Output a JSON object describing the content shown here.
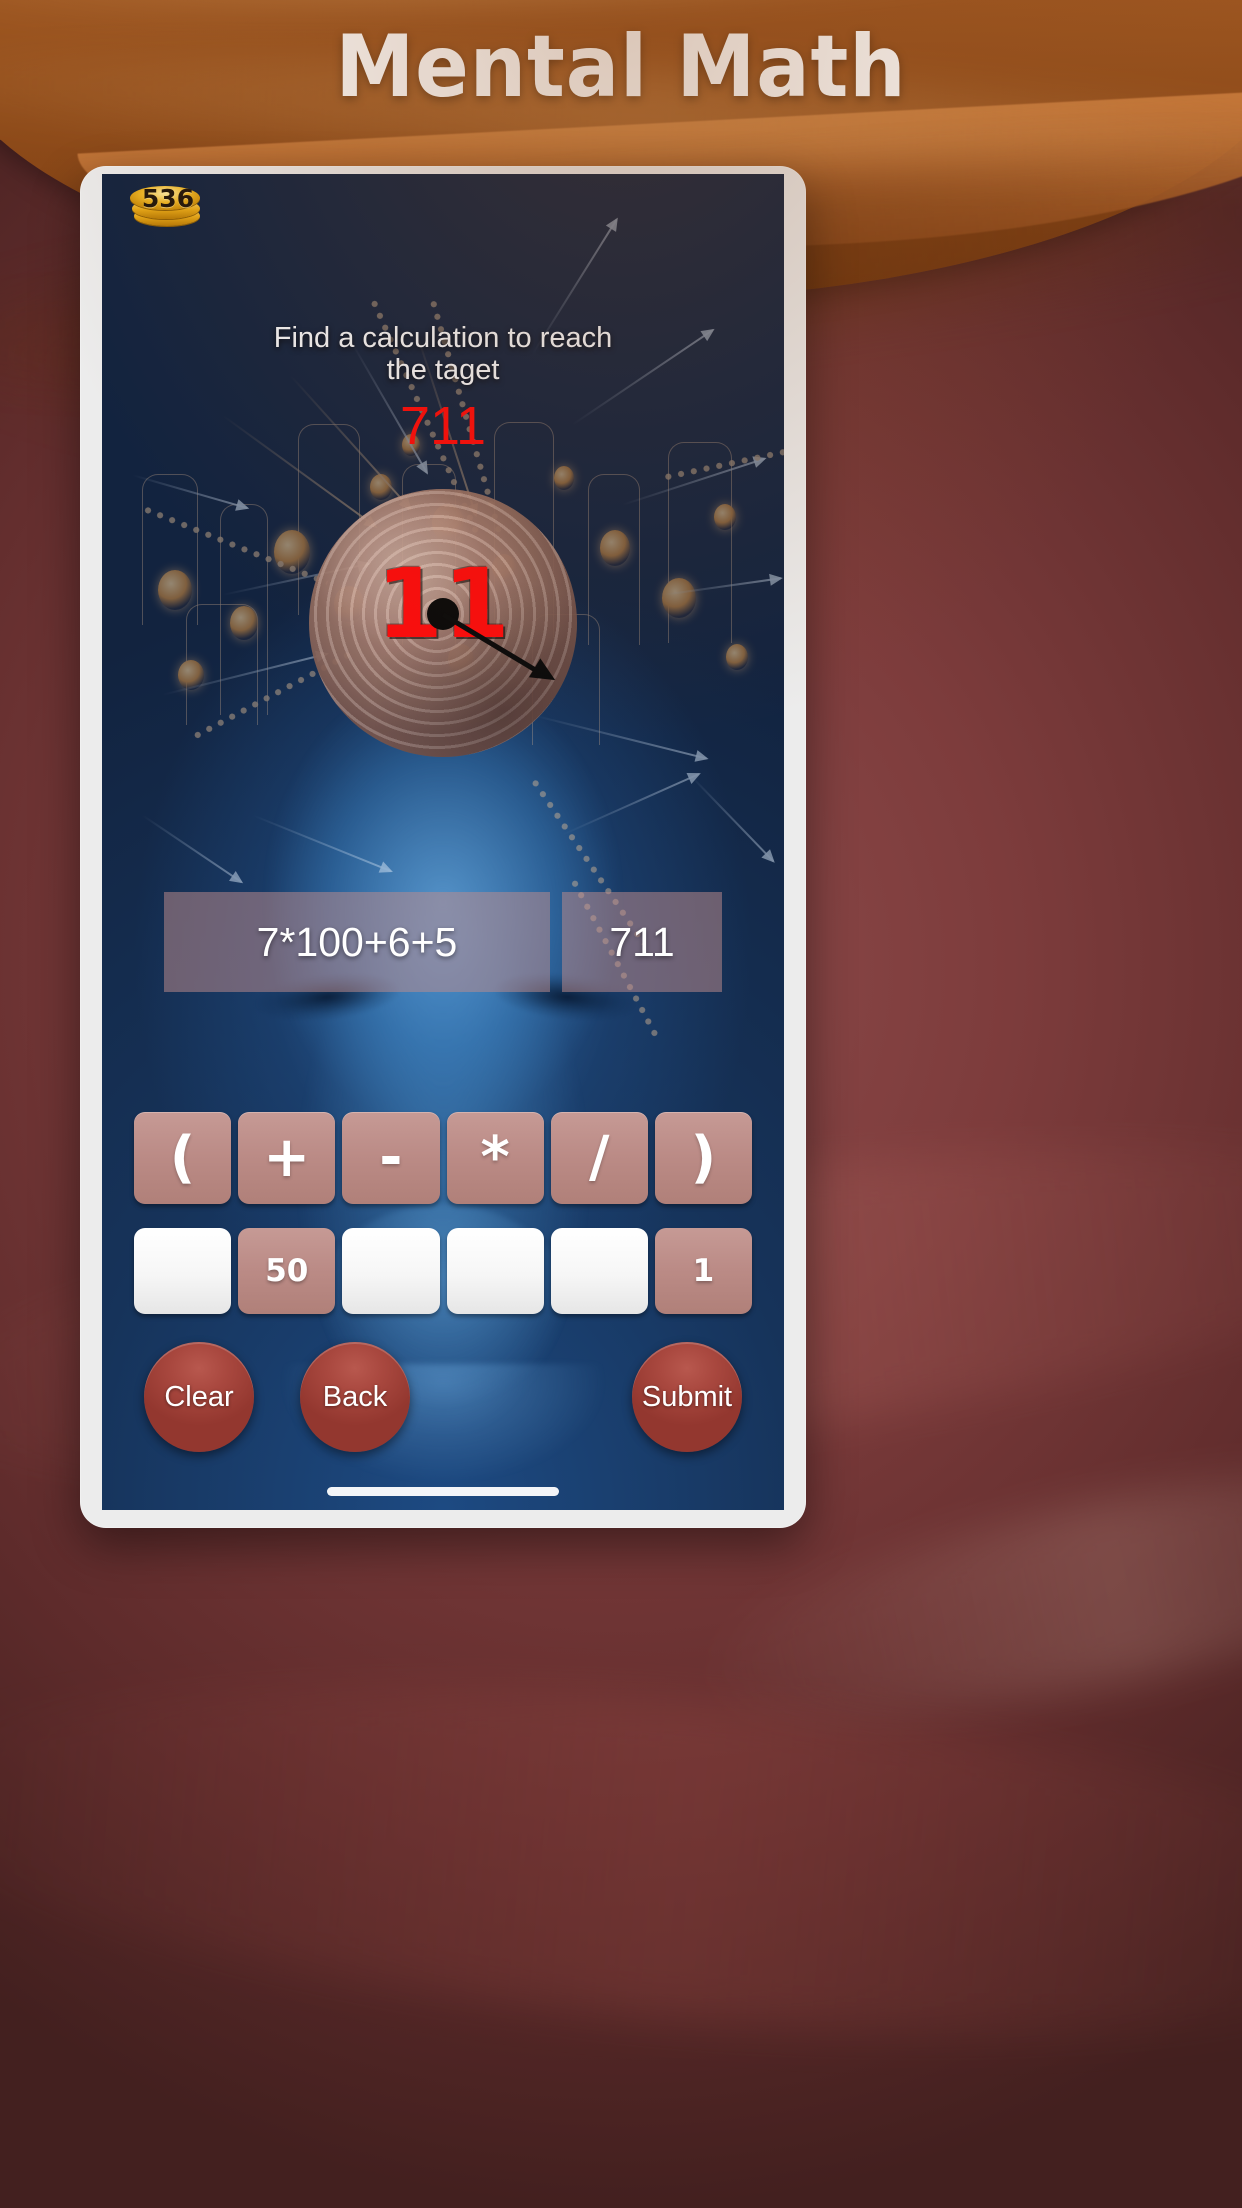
{
  "promo": {
    "title": "Mental Math",
    "background_color": "#8f4d1c"
  },
  "game": {
    "coins": "536",
    "prompt_line1": "Find a calculation to reach",
    "prompt_line2": "the taget",
    "target": "711",
    "target_color": "#fc0b0b",
    "timer": "11",
    "timer_color": "#fb0d0d",
    "expression": "7*100+6+5",
    "result": "711",
    "operators": [
      "(",
      "+",
      "-",
      "*",
      "/",
      ")"
    ],
    "numbers": [
      {
        "label": "",
        "state": "used"
      },
      {
        "label": "50",
        "state": "available"
      },
      {
        "label": "",
        "state": "used"
      },
      {
        "label": "",
        "state": "used"
      },
      {
        "label": "",
        "state": "used"
      },
      {
        "label": "1",
        "state": "available"
      }
    ],
    "actions": {
      "clear": "Clear",
      "back": "Back",
      "submit": "Submit"
    },
    "accent_color": "#bb8b86",
    "action_color": "#a9483f"
  }
}
